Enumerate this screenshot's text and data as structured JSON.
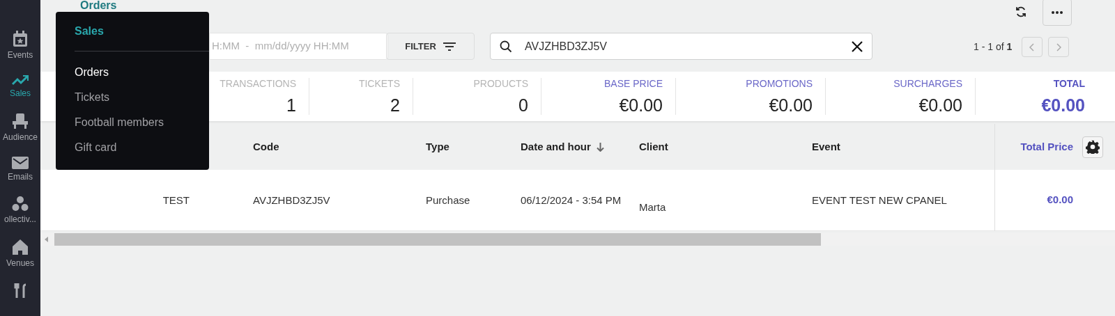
{
  "page_title": "Orders",
  "sidebar": {
    "items": [
      {
        "label": "Events",
        "selected": false
      },
      {
        "label": "Sales",
        "selected": true
      },
      {
        "label": "Audience",
        "selected": false
      },
      {
        "label": "Emails",
        "selected": false
      },
      {
        "label": "ollectiv...",
        "selected": false
      },
      {
        "label": "Venues",
        "selected": false
      },
      {
        "selected": false
      }
    ]
  },
  "menu": {
    "title": "Sales",
    "items": [
      {
        "label": "Orders",
        "selected": true
      },
      {
        "label": "Tickets",
        "selected": false
      },
      {
        "label": "Football members",
        "selected": false
      },
      {
        "label": "Gift card",
        "selected": false
      }
    ]
  },
  "toolbar": {
    "date_range": {
      "placeholder": "H:MM  -  mm/dd/yyyy HH:MM"
    },
    "filter_button": "FILTER",
    "search": {
      "value": "AVJZHBD3ZJ5V"
    },
    "pagination": "1 - 1 of **1**"
  },
  "stats": [
    {
      "label": "TRANSACTIONS",
      "value": "1",
      "kind": "plain"
    },
    {
      "label": "TICKETS",
      "value": "2",
      "kind": "plain"
    },
    {
      "label": "PRODUCTS",
      "value": "0",
      "kind": "plain"
    },
    {
      "label": "BASE PRICE",
      "value": "€0.00",
      "kind": "price"
    },
    {
      "label": "PROMOTIONS",
      "value": "€0.00",
      "kind": "price"
    },
    {
      "label": "SURCHARGES",
      "value": "€0.00",
      "kind": "price"
    },
    {
      "label": "TOTAL",
      "value": "€0.00",
      "kind": "total"
    }
  ],
  "table": {
    "columns": [
      {
        "kind": "plain"
      },
      {
        "label": "Code",
        "kind": "plain",
        "sorted": false
      },
      {
        "label": "Type",
        "kind": "plain",
        "sorted": false
      },
      {
        "label": "Date and hour",
        "kind": "plain",
        "sorted": true
      },
      {
        "label": "Client",
        "kind": "plain",
        "sorted": false
      },
      {
        "label": "Event",
        "kind": "plain",
        "sorted": false
      },
      {
        "label": "Total Price",
        "kind": "price",
        "sorted": false
      }
    ],
    "rows": [
      {
        "cells": [
          "TEST",
          "AVJZHBD3ZJ5V",
          "Purchase",
          "06/12/2024 - 3:54 PM",
          "Marta",
          "EVENT TEST NEW CPANEL",
          "€0.00"
        ]
      }
    ]
  }
}
